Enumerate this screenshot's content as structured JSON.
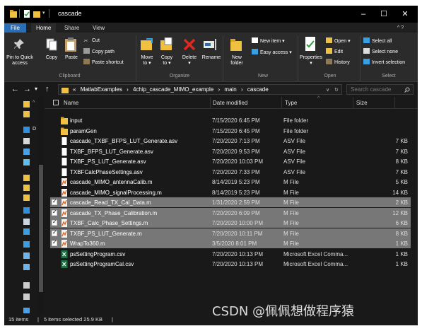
{
  "window": {
    "title": "cascade",
    "controls": {
      "minimize": "–",
      "maximize": "☐",
      "close": "✕"
    }
  },
  "ribbon": {
    "tabs": [
      {
        "label": "File"
      },
      {
        "label": "Home"
      },
      {
        "label": "Share"
      },
      {
        "label": "View"
      }
    ],
    "help_glyph": "^ ?",
    "clipboard": {
      "pin_label_1": "Pin to Quick",
      "pin_label_2": "access",
      "copy": "Copy",
      "paste": "Paste",
      "cut": "Cut",
      "copy_path": "Copy path",
      "paste_shortcut": "Paste shortcut",
      "group": "Clipboard"
    },
    "organize": {
      "move_1": "Move",
      "move_2": "to ▾",
      "copy_1": "Copy",
      "copy_2": "to ▾",
      "delete_1": "Delete",
      "delete_2": "▾",
      "rename": "Rename",
      "group": "Organize"
    },
    "new": {
      "new_folder_1": "New",
      "new_folder_2": "folder",
      "new_item": "New item ▾",
      "easy_access": "Easy access ▾",
      "group": "New"
    },
    "open": {
      "properties_1": "Properties",
      "properties_2": "▾",
      "open": "Open ▾",
      "edit": "Edit",
      "history": "History",
      "group": "Open"
    },
    "select": {
      "select_all": "Select all",
      "select_none": "Select none",
      "invert": "Invert selection",
      "group": "Select"
    }
  },
  "address": {
    "back": "←",
    "forward": "→",
    "recent": "▾",
    "up": "↑",
    "prefix": "«",
    "crumbs": [
      "MatlabExamples",
      "›",
      "4chip_cascade_MIMO_example",
      "›",
      "main",
      "›",
      "cascade"
    ],
    "dropdown": "∨",
    "refresh": "↻",
    "search_placeholder": "Search cascade"
  },
  "nav": {
    "items": [
      {
        "label": "",
        "icon": "folder-icon",
        "color": "#f0c040"
      },
      {
        "label": "",
        "icon": "folder-icon",
        "color": "#f0c040"
      },
      {
        "label": "D",
        "icon": "desktop-icon",
        "color": "#2f8fe0"
      },
      {
        "label": "",
        "icon": "user-icon",
        "color": "#d8d8d8"
      },
      {
        "label": "",
        "icon": "computer-icon",
        "color": "#4aa0e6"
      },
      {
        "label": "",
        "icon": "cube-icon",
        "color": "#5bc0eb"
      },
      {
        "label": "",
        "icon": "folder-icon",
        "color": "#f0c040"
      },
      {
        "label": "",
        "icon": "folder-icon",
        "color": "#f0c040"
      },
      {
        "label": "",
        "icon": "folder-icon",
        "color": "#f0c040"
      },
      {
        "label": "",
        "icon": "desktop-icon",
        "color": "#2f8fe0"
      },
      {
        "label": "",
        "icon": "document-icon",
        "color": "#c9d6e6"
      },
      {
        "label": "",
        "icon": "download-icon",
        "color": "#3a9ee0"
      },
      {
        "label": "",
        "icon": "music-icon",
        "color": "#3a9ee0"
      },
      {
        "label": "",
        "icon": "image-icon",
        "color": "#6fb3e8"
      },
      {
        "label": "",
        "icon": "video-icon",
        "color": "#6fb3e8"
      },
      {
        "label": "",
        "icon": "drive-icon",
        "color": "#cccccc"
      },
      {
        "label": "",
        "icon": "drive-icon",
        "color": "#cccccc"
      },
      {
        "label": "",
        "icon": "network-icon",
        "color": "#4aa0e6"
      }
    ]
  },
  "list": {
    "columns": {
      "name": "Name",
      "date": "Date modified",
      "type": "Type",
      "size": "Size"
    },
    "rows": [
      {
        "name": "input",
        "date": "7/15/2020 6:45 PM",
        "type": "File folder",
        "size": "",
        "icon": "folder-icon",
        "selected": false
      },
      {
        "name": "paramGen",
        "date": "7/15/2020 6:45 PM",
        "type": "File folder",
        "size": "",
        "icon": "folder-icon",
        "selected": false
      },
      {
        "name": "cascade_TXBF_BFPS_LUT_Generate.asv",
        "date": "7/20/2020 7:13 PM",
        "type": "ASV File",
        "size": "7 KB",
        "icon": "file-icon",
        "selected": false
      },
      {
        "name": "TXBF_BFPS_LUT_Generate.asv",
        "date": "7/20/2020 9:53 PM",
        "type": "ASV File",
        "size": "7 KB",
        "icon": "file-icon",
        "selected": false
      },
      {
        "name": "TXBF_PS_LUT_Generate.asv",
        "date": "7/20/2020 10:03 PM",
        "type": "ASV File",
        "size": "8 KB",
        "icon": "file-icon",
        "selected": false
      },
      {
        "name": "TXBFCalcPhaseSettings.asv",
        "date": "7/20/2020 7:33 PM",
        "type": "ASV File",
        "size": "7 KB",
        "icon": "file-icon",
        "selected": false
      },
      {
        "name": "cascade_MIMO_antennaCalib.m",
        "date": "8/14/2019 5:23 PM",
        "type": "M File",
        "size": "5 KB",
        "icon": "mfile-icon",
        "selected": false
      },
      {
        "name": "cascade_MIMO_signalProcessing.m",
        "date": "8/14/2019 5:23 PM",
        "type": "M File",
        "size": "14 KB",
        "icon": "mfile-icon",
        "selected": false
      },
      {
        "name": "cascade_Read_TX_Cal_Data.m",
        "date": "1/31/2020 2:59 PM",
        "type": "M File",
        "size": "2 KB",
        "icon": "mfile-icon",
        "selected": true
      },
      {
        "name": "cascade_TX_Phase_Calibration.m",
        "date": "7/20/2020 6:09 PM",
        "type": "M File",
        "size": "12 KB",
        "icon": "mfile-icon",
        "selected": true
      },
      {
        "name": "TXBF_Calc_Phase_Settings.m",
        "date": "7/20/2020 10:00 PM",
        "type": "M File",
        "size": "6 KB",
        "icon": "mfile-icon",
        "selected": true
      },
      {
        "name": "TXBF_PS_LUT_Generate.m",
        "date": "7/20/2020 10:11 PM",
        "type": "M File",
        "size": "8 KB",
        "icon": "mfile-icon",
        "selected": true
      },
      {
        "name": "WrapTo360.m",
        "date": "3/5/2020 8:01 PM",
        "type": "M File",
        "size": "1 KB",
        "icon": "mfile-icon",
        "selected": true
      },
      {
        "name": "psSettingProgram.csv",
        "date": "7/20/2020 10:13 PM",
        "type": "Microsoft Excel Comma...",
        "size": "1 KB",
        "icon": "excel-icon",
        "selected": false
      },
      {
        "name": "psSettingProgramCal.csv",
        "date": "7/20/2020 10:13 PM",
        "type": "Microsoft Excel Comma...",
        "size": "1 KB",
        "icon": "excel-icon",
        "selected": false
      }
    ]
  },
  "status": {
    "count": "15 items",
    "divider": "|",
    "selected": "5 items selected  25.9 KB",
    "divider2": "|"
  },
  "watermark": "CSDN @佩佩想做程序猿",
  "colors": {
    "accent": "#2a6fb5",
    "selection": "#777777",
    "folder": "#f0c040",
    "background": "#191919"
  }
}
